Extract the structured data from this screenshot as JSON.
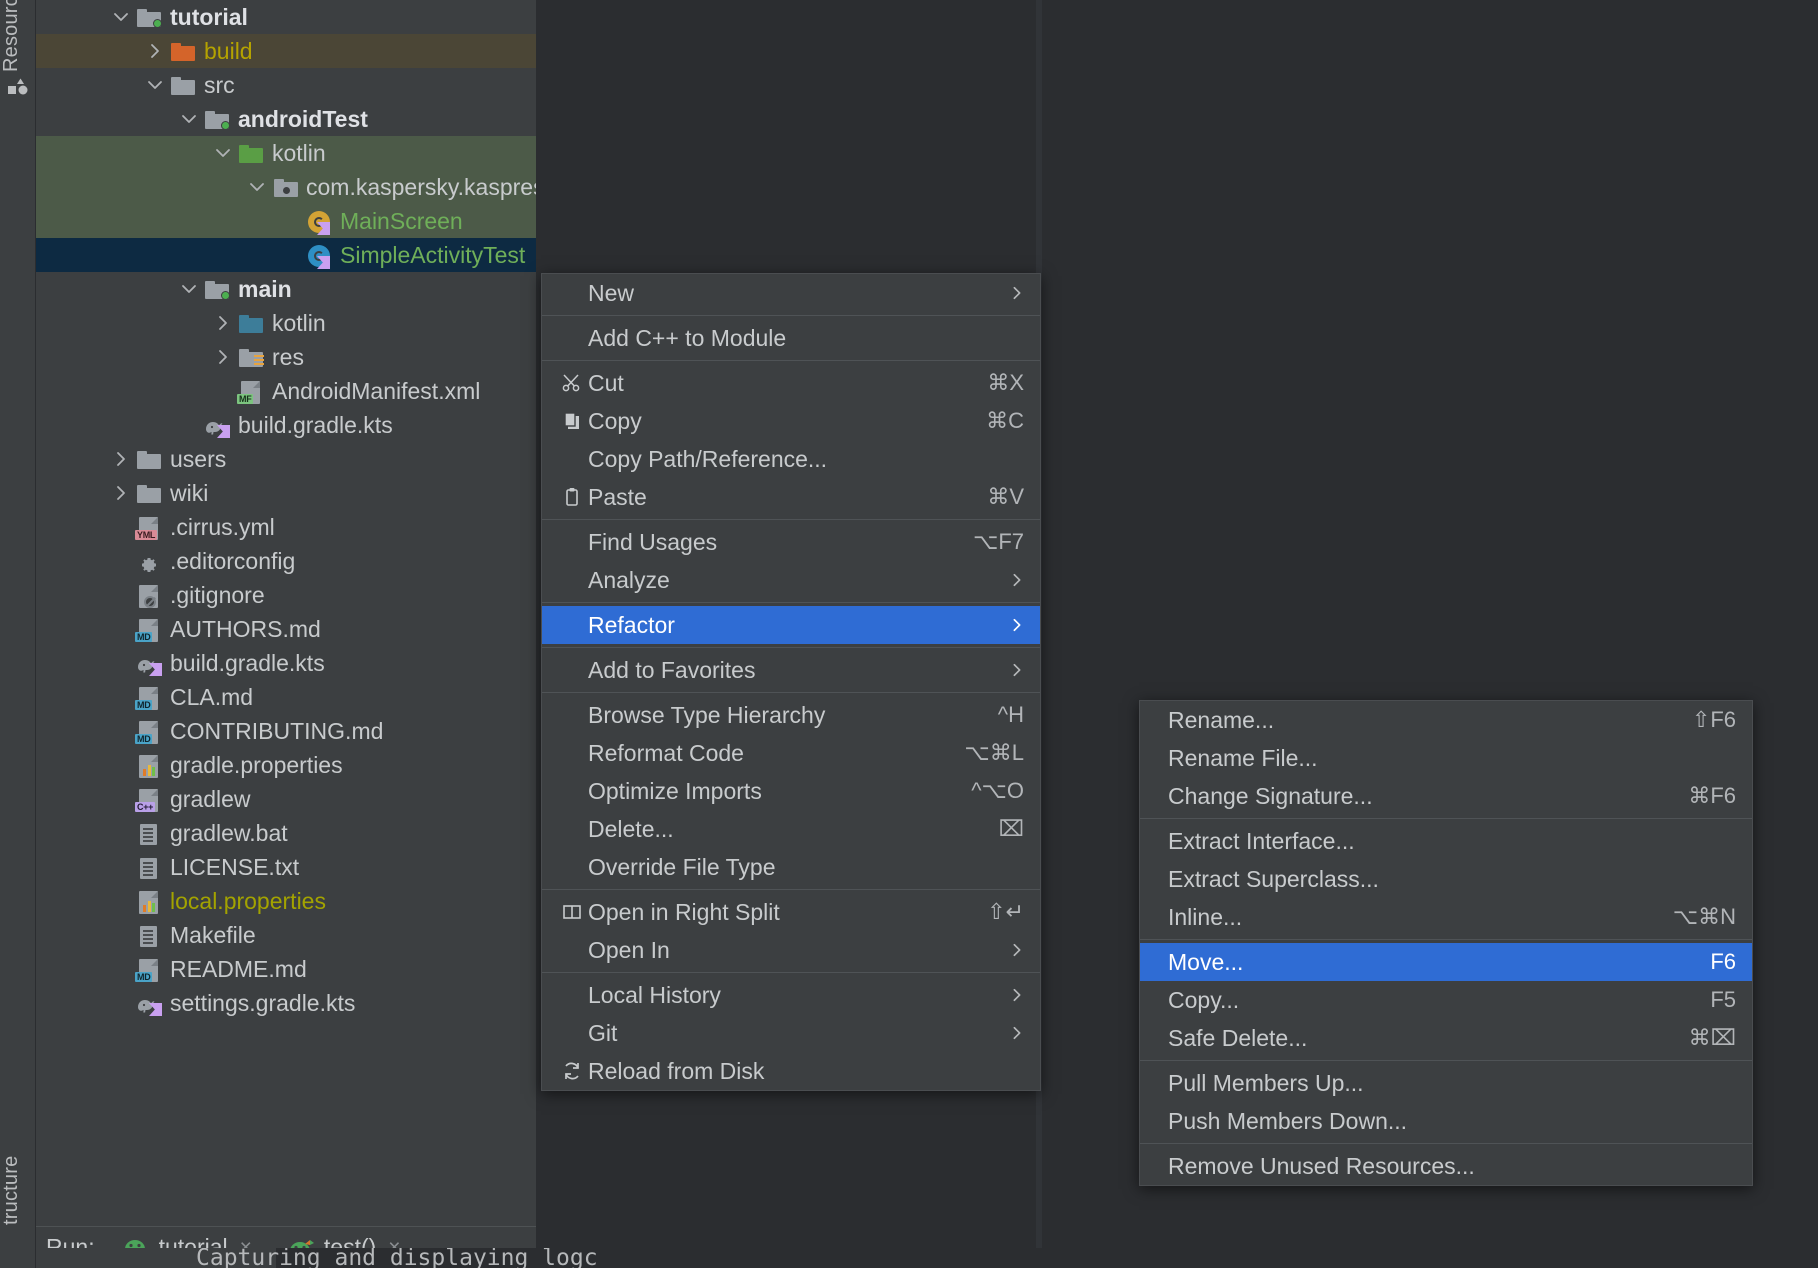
{
  "toolwindows": {
    "resource_tab": "Resourc",
    "structure_tab": "tructure"
  },
  "project_tree": {
    "rows": [
      {
        "id": "tutorial",
        "label": "tutorial",
        "indent": 2,
        "arrow": "down",
        "icon": "module-folder-green-dot",
        "style": "bold",
        "row_bg": "none"
      },
      {
        "id": "build",
        "label": "build",
        "indent": 3,
        "arrow": "right",
        "icon": "folder-orange",
        "style": "yellow",
        "row_bg": "build"
      },
      {
        "id": "src",
        "label": "src",
        "indent": 3,
        "arrow": "down",
        "icon": "folder-gray",
        "style": "normal",
        "row_bg": "none"
      },
      {
        "id": "androidTest",
        "label": "androidTest",
        "indent": 4,
        "arrow": "down",
        "icon": "module-folder-green-dot",
        "style": "bold",
        "row_bg": "none"
      },
      {
        "id": "kotlin-test",
        "label": "kotlin",
        "indent": 5,
        "arrow": "down",
        "icon": "folder-green",
        "style": "normal",
        "row_bg": "green"
      },
      {
        "id": "package",
        "label": "com.kaspersky.kaspresso.tutorial.screen",
        "indent": 6,
        "arrow": "down",
        "icon": "package",
        "style": "normal",
        "row_bg": "green"
      },
      {
        "id": "MainScreen",
        "label": "MainScreen",
        "indent": 7,
        "arrow": "none",
        "icon": "kotlin-object",
        "style": "green-text",
        "row_bg": "green"
      },
      {
        "id": "SimpleActivityTest",
        "label": "SimpleActivityTest",
        "indent": 7,
        "arrow": "none",
        "icon": "kotlin-class",
        "style": "green-text",
        "row_bg": "selected"
      },
      {
        "id": "main",
        "label": "main",
        "indent": 4,
        "arrow": "down",
        "icon": "module-folder-green-dot",
        "style": "bold",
        "row_bg": "none"
      },
      {
        "id": "kotlin-main",
        "label": "kotlin",
        "indent": 5,
        "arrow": "right",
        "icon": "folder-blue",
        "style": "normal",
        "row_bg": "none"
      },
      {
        "id": "res",
        "label": "res",
        "indent": 5,
        "arrow": "right",
        "icon": "folder-res",
        "style": "normal",
        "row_bg": "none"
      },
      {
        "id": "AndroidManifest.xml",
        "label": "AndroidManifest.xml",
        "indent": 5,
        "arrow": "none",
        "icon": "file-mf",
        "style": "normal",
        "row_bg": "none"
      },
      {
        "id": "build.gradle.kts-1",
        "label": "build.gradle.kts",
        "indent": 4,
        "arrow": "none",
        "icon": "gradle-kts",
        "style": "normal",
        "row_bg": "none"
      },
      {
        "id": "users",
        "label": "users",
        "indent": 2,
        "arrow": "right",
        "icon": "folder-gray",
        "style": "normal",
        "row_bg": "none"
      },
      {
        "id": "wiki",
        "label": "wiki",
        "indent": 2,
        "arrow": "right",
        "icon": "folder-gray",
        "style": "normal",
        "row_bg": "none"
      },
      {
        "id": ".cirrus.yml",
        "label": ".cirrus.yml",
        "indent": 2,
        "arrow": "none",
        "icon": "file-yml",
        "style": "normal",
        "row_bg": "none"
      },
      {
        "id": ".editorconfig",
        "label": ".editorconfig",
        "indent": 2,
        "arrow": "none",
        "icon": "gear",
        "style": "normal",
        "row_bg": "none"
      },
      {
        "id": ".gitignore",
        "label": ".gitignore",
        "indent": 2,
        "arrow": "none",
        "icon": "file-ignore",
        "style": "normal",
        "row_bg": "none"
      },
      {
        "id": "AUTHORS.md",
        "label": "AUTHORS.md",
        "indent": 2,
        "arrow": "none",
        "icon": "file-md",
        "style": "normal",
        "row_bg": "none"
      },
      {
        "id": "build.gradle.kts-2",
        "label": "build.gradle.kts",
        "indent": 2,
        "arrow": "none",
        "icon": "gradle-kts",
        "style": "normal",
        "row_bg": "none"
      },
      {
        "id": "CLA.md",
        "label": "CLA.md",
        "indent": 2,
        "arrow": "none",
        "icon": "file-md",
        "style": "normal",
        "row_bg": "none"
      },
      {
        "id": "CONTRIBUTING.md",
        "label": "CONTRIBUTING.md",
        "indent": 2,
        "arrow": "none",
        "icon": "file-md",
        "style": "normal",
        "row_bg": "none"
      },
      {
        "id": "gradle.properties",
        "label": "gradle.properties",
        "indent": 2,
        "arrow": "none",
        "icon": "file-properties",
        "style": "normal",
        "row_bg": "none"
      },
      {
        "id": "gradlew",
        "label": "gradlew",
        "indent": 2,
        "arrow": "none",
        "icon": "file-cpp",
        "style": "normal",
        "row_bg": "none"
      },
      {
        "id": "gradlew.bat",
        "label": "gradlew.bat",
        "indent": 2,
        "arrow": "none",
        "icon": "file-text",
        "style": "normal",
        "row_bg": "none"
      },
      {
        "id": "LICENSE.txt",
        "label": "LICENSE.txt",
        "indent": 2,
        "arrow": "none",
        "icon": "file-text",
        "style": "normal",
        "row_bg": "none"
      },
      {
        "id": "local.properties",
        "label": "local.properties",
        "indent": 2,
        "arrow": "none",
        "icon": "file-properties",
        "style": "olive",
        "row_bg": "none"
      },
      {
        "id": "Makefile",
        "label": "Makefile",
        "indent": 2,
        "arrow": "none",
        "icon": "file-text",
        "style": "normal",
        "row_bg": "none"
      },
      {
        "id": "README.md",
        "label": "README.md",
        "indent": 2,
        "arrow": "none",
        "icon": "file-md",
        "style": "normal",
        "row_bg": "none"
      },
      {
        "id": "settings.gradle.kts",
        "label": "settings.gradle.kts",
        "indent": 2,
        "arrow": "none",
        "icon": "gradle-kts",
        "style": "normal",
        "row_bg": "none"
      }
    ]
  },
  "run_bar": {
    "label": "Run:",
    "tabs": [
      {
        "name": "tutorial",
        "close": "×",
        "active": true
      },
      {
        "name": "test()",
        "close": "×",
        "active": false
      }
    ]
  },
  "console": {
    "text": "Capturing and displaying logc"
  },
  "context_menu": {
    "groups": [
      [
        {
          "label": "New",
          "icon": "",
          "key": "",
          "arrow": true
        }
      ],
      [
        {
          "label": "Add C++ to Module",
          "icon": "",
          "key": "",
          "arrow": false
        }
      ],
      [
        {
          "label": "Cut",
          "icon": "scissors-icon",
          "key": "⌘X",
          "arrow": false
        },
        {
          "label": "Copy",
          "icon": "copy-icon",
          "key": "⌘C",
          "arrow": false
        },
        {
          "label": "Copy Path/Reference...",
          "icon": "",
          "key": "",
          "arrow": false
        },
        {
          "label": "Paste",
          "icon": "clipboard-icon",
          "key": "⌘V",
          "arrow": false
        }
      ],
      [
        {
          "label": "Find Usages",
          "icon": "",
          "key": "⌥F7",
          "arrow": false
        },
        {
          "label": "Analyze",
          "icon": "",
          "key": "",
          "arrow": true
        }
      ],
      [
        {
          "label": "Refactor",
          "icon": "",
          "key": "",
          "arrow": true,
          "selected": true
        }
      ],
      [
        {
          "label": "Add to Favorites",
          "icon": "",
          "key": "",
          "arrow": true
        }
      ],
      [
        {
          "label": "Browse Type Hierarchy",
          "icon": "",
          "key": "^H",
          "arrow": false
        },
        {
          "label": "Reformat Code",
          "icon": "",
          "key": "⌥⌘L",
          "arrow": false
        },
        {
          "label": "Optimize Imports",
          "icon": "",
          "key": "^⌥O",
          "arrow": false
        },
        {
          "label": "Delete...",
          "icon": "",
          "key": "⌧",
          "arrow": false
        },
        {
          "label": "Override File Type",
          "icon": "",
          "key": "",
          "arrow": false
        }
      ],
      [
        {
          "label": "Open in Right Split",
          "icon": "split-icon",
          "key": "⇧↵",
          "arrow": false
        },
        {
          "label": "Open In",
          "icon": "",
          "key": "",
          "arrow": true
        }
      ],
      [
        {
          "label": "Local History",
          "icon": "",
          "key": "",
          "arrow": true
        },
        {
          "label": "Git",
          "icon": "",
          "key": "",
          "arrow": true
        },
        {
          "label": "Reload from Disk",
          "icon": "refresh-icon",
          "key": "",
          "arrow": false
        }
      ]
    ]
  },
  "refactor_submenu": {
    "groups": [
      [
        {
          "label": "Rename...",
          "key": "⇧F6"
        },
        {
          "label": "Rename File...",
          "key": ""
        },
        {
          "label": "Change Signature...",
          "key": "⌘F6"
        }
      ],
      [
        {
          "label": "Extract Interface...",
          "key": ""
        },
        {
          "label": "Extract Superclass...",
          "key": ""
        },
        {
          "label": "Inline...",
          "key": "⌥⌘N"
        }
      ],
      [
        {
          "label": "Move...",
          "key": "F6",
          "selected": true
        },
        {
          "label": "Copy...",
          "key": "F5"
        },
        {
          "label": "Safe Delete...",
          "key": "⌘⌧"
        }
      ],
      [
        {
          "label": "Pull Members Up...",
          "key": ""
        },
        {
          "label": "Push Members Down...",
          "key": ""
        }
      ],
      [
        {
          "label": "Remove Unused Resources...",
          "key": ""
        }
      ]
    ]
  },
  "colors": {
    "panel_bg": "#3c3f41",
    "editor_bg": "#2b2d30",
    "selection_blue": "#2f6cd4",
    "row_selected": "#0d2a42",
    "row_green": "#4c5a48",
    "row_build": "#4b4636",
    "text": "#c8cbcd",
    "kotlin_green": "#6faf59",
    "olive": "#a3a300"
  }
}
